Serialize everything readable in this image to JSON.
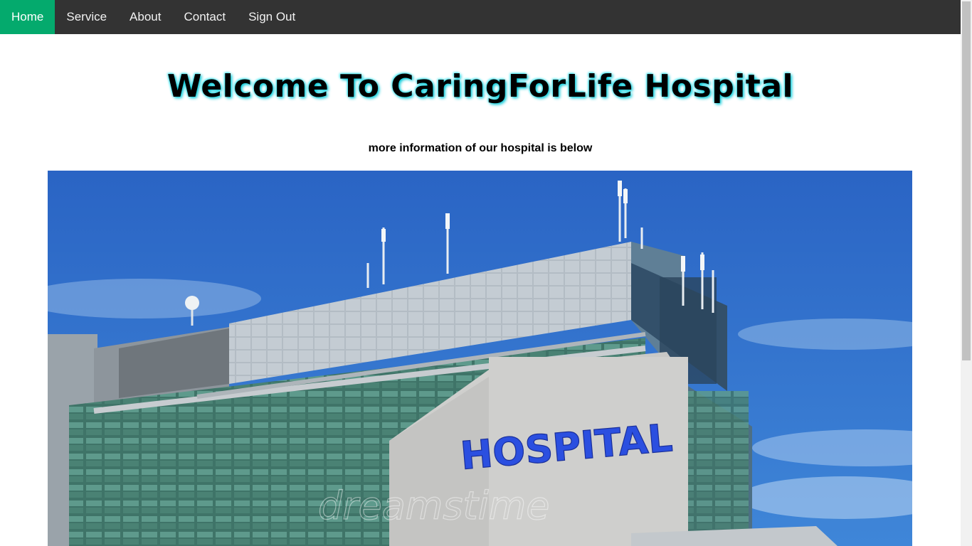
{
  "nav": {
    "items": [
      {
        "label": "Home",
        "active": true
      },
      {
        "label": "Service",
        "active": false
      },
      {
        "label": "About",
        "active": false
      },
      {
        "label": "Contact",
        "active": false
      },
      {
        "label": "Sign Out",
        "active": false
      }
    ]
  },
  "main": {
    "heading": "Welcome To CaringForLife Hospital",
    "subheading": "more information of our hospital is below"
  },
  "hero": {
    "sign_text": "HOSPITAL",
    "watermark": "dreamstime"
  },
  "colors": {
    "nav_bg": "#333333",
    "nav_active": "#04AA6D",
    "sky": "#2f6fc9",
    "sign": "#2b4fe0",
    "heading_glow": "#00c8d7"
  }
}
